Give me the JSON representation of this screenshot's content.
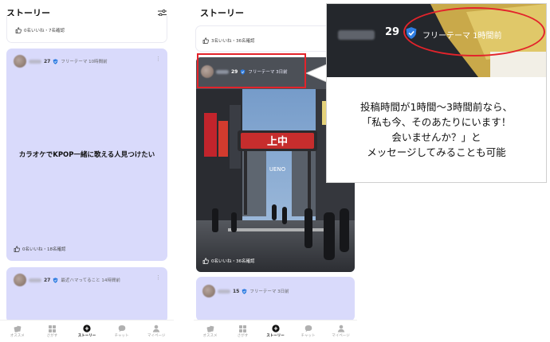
{
  "left_screen": {
    "header": {
      "title": "ストーリー"
    },
    "top_card": {
      "likes": "0名いいね・7名確認"
    },
    "main_card": {
      "age": "27",
      "meta": "フリーテーマ 10時間前",
      "text": "カラオケでKPOP一緒に歌える人見つけたい",
      "likes": "0名いいね・18名確認"
    },
    "next_card": {
      "age": "27",
      "meta": "最近ハマってること 14時間前"
    },
    "tabs": [
      {
        "label": "オススメ",
        "icon": "cards-icon"
      },
      {
        "label": "さがす",
        "icon": "grid-icon"
      },
      {
        "label": "ストーリー",
        "icon": "plus-circle-icon"
      },
      {
        "label": "チャット",
        "icon": "chat-icon"
      },
      {
        "label": "マイページ",
        "icon": "person-icon"
      }
    ],
    "active_tab": "ストーリー"
  },
  "right_screen": {
    "header": {
      "title": "ストーリー"
    },
    "top_card": {
      "likes": "3名いいね・36名確認"
    },
    "photo_card": {
      "age": "29",
      "meta": "フリーテーマ 3日前",
      "sign_main": "上中",
      "sign_sub": "UENO",
      "likes": "0名いいね・36名確認"
    },
    "next_card": {
      "age": "15",
      "meta": "フリーテーマ 3日前"
    },
    "tabs": [
      {
        "label": "オススメ",
        "icon": "cards-icon"
      },
      {
        "label": "さがす",
        "icon": "grid-icon"
      },
      {
        "label": "ストーリー",
        "icon": "plus-circle-icon"
      },
      {
        "label": "チャット",
        "icon": "chat-icon"
      },
      {
        "label": "マイページ",
        "icon": "person-icon"
      }
    ]
  },
  "callout": {
    "zoom_age": "29",
    "zoom_meta": "フリーテーマ 1時間前",
    "lines": [
      "投稿時間が1時間〜3時間前なら、",
      "「私も今、そのあたりにいます！",
      "会いませんか？」と",
      "メッセージしてみることも可能"
    ]
  },
  "colors": {
    "card_lavender": "#d9dafb",
    "highlight_red": "#e3232b",
    "verified_blue": "#2f7de1"
  }
}
